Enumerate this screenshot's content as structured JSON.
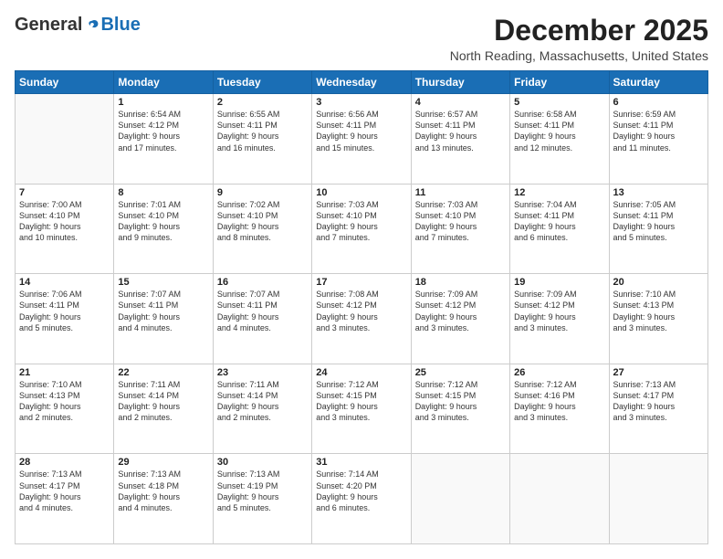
{
  "logo": {
    "general": "General",
    "blue": "Blue"
  },
  "header": {
    "month": "December 2025",
    "location": "North Reading, Massachusetts, United States"
  },
  "days_of_week": [
    "Sunday",
    "Monday",
    "Tuesday",
    "Wednesday",
    "Thursday",
    "Friday",
    "Saturday"
  ],
  "weeks": [
    [
      {
        "day": "",
        "info": ""
      },
      {
        "day": "1",
        "info": "Sunrise: 6:54 AM\nSunset: 4:12 PM\nDaylight: 9 hours\nand 17 minutes."
      },
      {
        "day": "2",
        "info": "Sunrise: 6:55 AM\nSunset: 4:11 PM\nDaylight: 9 hours\nand 16 minutes."
      },
      {
        "day": "3",
        "info": "Sunrise: 6:56 AM\nSunset: 4:11 PM\nDaylight: 9 hours\nand 15 minutes."
      },
      {
        "day": "4",
        "info": "Sunrise: 6:57 AM\nSunset: 4:11 PM\nDaylight: 9 hours\nand 13 minutes."
      },
      {
        "day": "5",
        "info": "Sunrise: 6:58 AM\nSunset: 4:11 PM\nDaylight: 9 hours\nand 12 minutes."
      },
      {
        "day": "6",
        "info": "Sunrise: 6:59 AM\nSunset: 4:11 PM\nDaylight: 9 hours\nand 11 minutes."
      }
    ],
    [
      {
        "day": "7",
        "info": "Sunrise: 7:00 AM\nSunset: 4:10 PM\nDaylight: 9 hours\nand 10 minutes."
      },
      {
        "day": "8",
        "info": "Sunrise: 7:01 AM\nSunset: 4:10 PM\nDaylight: 9 hours\nand 9 minutes."
      },
      {
        "day": "9",
        "info": "Sunrise: 7:02 AM\nSunset: 4:10 PM\nDaylight: 9 hours\nand 8 minutes."
      },
      {
        "day": "10",
        "info": "Sunrise: 7:03 AM\nSunset: 4:10 PM\nDaylight: 9 hours\nand 7 minutes."
      },
      {
        "day": "11",
        "info": "Sunrise: 7:03 AM\nSunset: 4:10 PM\nDaylight: 9 hours\nand 7 minutes."
      },
      {
        "day": "12",
        "info": "Sunrise: 7:04 AM\nSunset: 4:11 PM\nDaylight: 9 hours\nand 6 minutes."
      },
      {
        "day": "13",
        "info": "Sunrise: 7:05 AM\nSunset: 4:11 PM\nDaylight: 9 hours\nand 5 minutes."
      }
    ],
    [
      {
        "day": "14",
        "info": "Sunrise: 7:06 AM\nSunset: 4:11 PM\nDaylight: 9 hours\nand 5 minutes."
      },
      {
        "day": "15",
        "info": "Sunrise: 7:07 AM\nSunset: 4:11 PM\nDaylight: 9 hours\nand 4 minutes."
      },
      {
        "day": "16",
        "info": "Sunrise: 7:07 AM\nSunset: 4:11 PM\nDaylight: 9 hours\nand 4 minutes."
      },
      {
        "day": "17",
        "info": "Sunrise: 7:08 AM\nSunset: 4:12 PM\nDaylight: 9 hours\nand 3 minutes."
      },
      {
        "day": "18",
        "info": "Sunrise: 7:09 AM\nSunset: 4:12 PM\nDaylight: 9 hours\nand 3 minutes."
      },
      {
        "day": "19",
        "info": "Sunrise: 7:09 AM\nSunset: 4:12 PM\nDaylight: 9 hours\nand 3 minutes."
      },
      {
        "day": "20",
        "info": "Sunrise: 7:10 AM\nSunset: 4:13 PM\nDaylight: 9 hours\nand 3 minutes."
      }
    ],
    [
      {
        "day": "21",
        "info": "Sunrise: 7:10 AM\nSunset: 4:13 PM\nDaylight: 9 hours\nand 2 minutes."
      },
      {
        "day": "22",
        "info": "Sunrise: 7:11 AM\nSunset: 4:14 PM\nDaylight: 9 hours\nand 2 minutes."
      },
      {
        "day": "23",
        "info": "Sunrise: 7:11 AM\nSunset: 4:14 PM\nDaylight: 9 hours\nand 2 minutes."
      },
      {
        "day": "24",
        "info": "Sunrise: 7:12 AM\nSunset: 4:15 PM\nDaylight: 9 hours\nand 3 minutes."
      },
      {
        "day": "25",
        "info": "Sunrise: 7:12 AM\nSunset: 4:15 PM\nDaylight: 9 hours\nand 3 minutes."
      },
      {
        "day": "26",
        "info": "Sunrise: 7:12 AM\nSunset: 4:16 PM\nDaylight: 9 hours\nand 3 minutes."
      },
      {
        "day": "27",
        "info": "Sunrise: 7:13 AM\nSunset: 4:17 PM\nDaylight: 9 hours\nand 3 minutes."
      }
    ],
    [
      {
        "day": "28",
        "info": "Sunrise: 7:13 AM\nSunset: 4:17 PM\nDaylight: 9 hours\nand 4 minutes."
      },
      {
        "day": "29",
        "info": "Sunrise: 7:13 AM\nSunset: 4:18 PM\nDaylight: 9 hours\nand 4 minutes."
      },
      {
        "day": "30",
        "info": "Sunrise: 7:13 AM\nSunset: 4:19 PM\nDaylight: 9 hours\nand 5 minutes."
      },
      {
        "day": "31",
        "info": "Sunrise: 7:14 AM\nSunset: 4:20 PM\nDaylight: 9 hours\nand 6 minutes."
      },
      {
        "day": "",
        "info": ""
      },
      {
        "day": "",
        "info": ""
      },
      {
        "day": "",
        "info": ""
      }
    ]
  ]
}
